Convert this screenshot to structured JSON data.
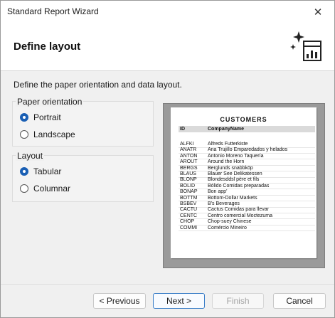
{
  "window": {
    "title": "Standard Report Wizard",
    "close_glyph": "✕"
  },
  "header": {
    "title": "Define layout",
    "icon": "wizard-sparkle-report-icon"
  },
  "instruction": "Define the paper orientation and data layout.",
  "orientation": {
    "label": "Paper orientation",
    "options": [
      {
        "label": "Portrait",
        "checked": true
      },
      {
        "label": "Landscape",
        "checked": false
      }
    ]
  },
  "layout": {
    "label": "Layout",
    "options": [
      {
        "label": "Tabular",
        "checked": true
      },
      {
        "label": "Columnar",
        "checked": false
      }
    ]
  },
  "preview": {
    "title": "CUSTOMERS",
    "columns": [
      "ID",
      "CompanyName"
    ],
    "rows": [
      [
        "ALFKI",
        "Alfreds Futterkiste"
      ],
      [
        "ANATR",
        "Ana Trujillo Emparedados y helados"
      ],
      [
        "ANTON",
        "Antonio Moreno Taquería"
      ],
      [
        "AROUT",
        "Around the Horn"
      ],
      [
        "BERGS",
        "Berglunds snabbköp"
      ],
      [
        "BLAUS",
        "Blauer See Delikatessen"
      ],
      [
        "BLONP",
        "Blondesddsl père et fils"
      ],
      [
        "BOLID",
        "Bólido Comidas preparadas"
      ],
      [
        "BONAP",
        "Bon app'"
      ],
      [
        "BOTTM",
        "Bottom-Dollar Markets"
      ],
      [
        "BSBEV",
        "B's Beverages"
      ],
      [
        "CACTU",
        "Cactus Comidas para llevar"
      ],
      [
        "CENTC",
        "Centro comercial Moctezuma"
      ],
      [
        "CHOP",
        "Chop-suey Chinese"
      ],
      [
        "COMMI",
        "Comércio Mineiro"
      ]
    ]
  },
  "buttons": {
    "previous": "< Previous",
    "next": "Next >",
    "finish": "Finish",
    "cancel": "Cancel"
  },
  "colors": {
    "accent": "#1a5fb4",
    "preview_background": "#9a9a9a"
  }
}
